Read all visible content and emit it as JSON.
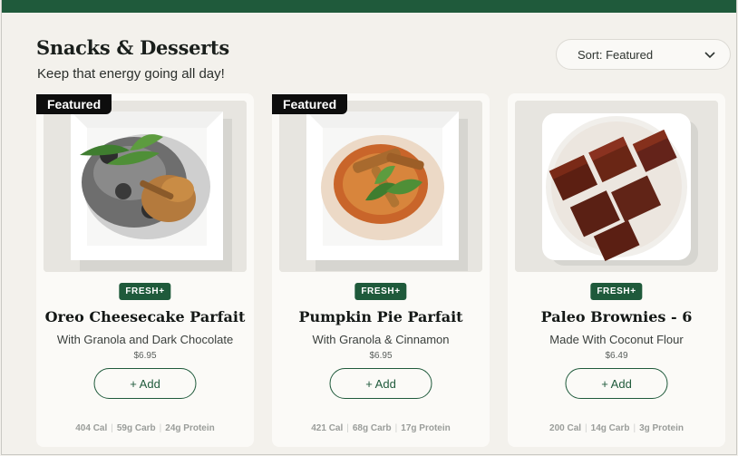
{
  "header": {
    "title": "Snacks & Desserts",
    "subtitle": "Keep that energy going all day!"
  },
  "sort": {
    "label": "Sort: Featured",
    "icon": "chevron-down-icon"
  },
  "colors": {
    "brand_green": "#1f5a3b",
    "featured_badge": "#0d0d0d",
    "background": "#f3f1ec"
  },
  "products": [
    {
      "featured_label": "Featured",
      "tag": "FRESH+",
      "name": "Oreo Cheesecake Parfait",
      "description": "With Granola and Dark Chocolate",
      "price": "$6.95",
      "add_label": "+ Add",
      "cal": "404 Cal",
      "carb": "59g Carb",
      "protein": "24g Protein"
    },
    {
      "featured_label": "Featured",
      "tag": "FRESH+",
      "name": "Pumpkin Pie Parfait",
      "description": "With Granola & Cinnamon",
      "price": "$6.95",
      "add_label": "+ Add",
      "cal": "421 Cal",
      "carb": "68g Carb",
      "protein": "17g Protein"
    },
    {
      "tag": "FRESH+",
      "name": "Paleo Brownies - 6",
      "description": "Made With Coconut Flour",
      "price": "$6.49",
      "add_label": "+ Add",
      "cal": "200 Cal",
      "carb": "14g Carb",
      "protein": "3g Protein"
    }
  ]
}
